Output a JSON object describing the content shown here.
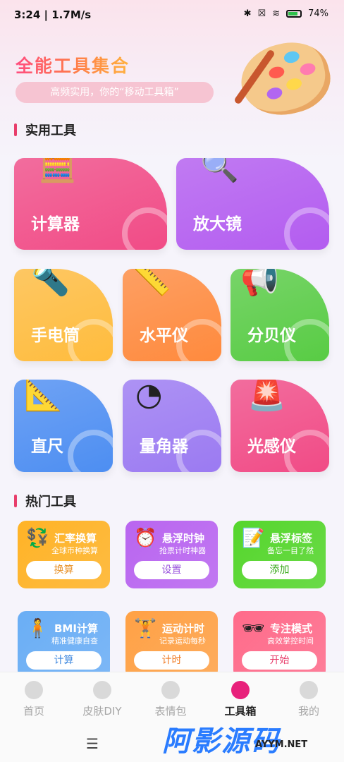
{
  "status_bar": {
    "time": "3:24",
    "speed": "1.7M/s",
    "battery": "74%"
  },
  "header": {
    "title": "全能工具集合",
    "subtitle": "高频实用，你的“移动工具箱”"
  },
  "sections": {
    "practical": "实用工具",
    "hot": "热门工具"
  },
  "tools": [
    {
      "label": "计算器",
      "icon": "calculator-icon",
      "color": "#f14b86"
    },
    {
      "label": "放大镜",
      "icon": "magnifier-icon",
      "color": "#b35cf0"
    },
    {
      "label": "手电筒",
      "icon": "flashlight-icon",
      "color": "#ffbc3d"
    },
    {
      "label": "水平仪",
      "icon": "level-icon",
      "color": "#ff8a3d"
    },
    {
      "label": "分贝仪",
      "icon": "megaphone-icon",
      "color": "#58cc44"
    },
    {
      "label": "直尺",
      "icon": "ruler-icon",
      "color": "#4d8ef2"
    },
    {
      "label": "量角器",
      "icon": "protractor-icon",
      "color": "#9b7af2"
    },
    {
      "label": "光感仪",
      "icon": "alarm-light-icon",
      "color": "#f14b86"
    }
  ],
  "hot_tools": [
    {
      "title": "汇率换算",
      "sub": "全球币种换算",
      "button": "换算",
      "icon": "currency-icon",
      "color": "#ffb326",
      "btn_color": "#e8922a"
    },
    {
      "title": "悬浮时钟",
      "sub": "抢票计时神器",
      "button": "设置",
      "icon": "clock-icon",
      "color": "#b965f0",
      "btn_color": "#9a55dd"
    },
    {
      "title": "悬浮标签",
      "sub": "备忘一目了然",
      "button": "添加",
      "icon": "sticky-note-icon",
      "color": "#55d62c",
      "btn_color": "#3aaa1c"
    },
    {
      "title": "BMI计算",
      "sub": "精准健康自查",
      "button": "计算",
      "icon": "bmi-icon",
      "color": "#6aaef5",
      "btn_color": "#3f88df"
    },
    {
      "title": "运动计时",
      "sub": "记录运动每秒",
      "button": "计时",
      "icon": "dumbbell-icon",
      "color": "#ffa145",
      "btn_color": "#f07a22"
    },
    {
      "title": "专注模式",
      "sub": "高效掌控时间",
      "button": "开始",
      "icon": "sunglasses-icon",
      "color": "#ff6b8a",
      "btn_color": "#e83d6b"
    }
  ],
  "tabs": [
    {
      "label": "首页",
      "icon": "home-icon"
    },
    {
      "label": "皮肤DIY",
      "icon": "palette-icon"
    },
    {
      "label": "表情包",
      "icon": "emoji-icon"
    },
    {
      "label": "工具箱",
      "icon": "toolbox-icon"
    },
    {
      "label": "我的",
      "icon": "profile-icon"
    }
  ],
  "watermark": {
    "main": "阿影源码",
    "sub": "AYYM.NET"
  }
}
